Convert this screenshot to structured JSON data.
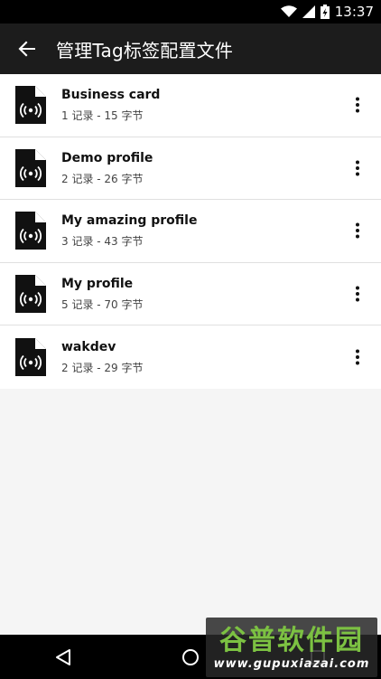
{
  "status_bar": {
    "time": "13:37"
  },
  "app_bar": {
    "title": "管理Tag标签配置文件"
  },
  "profiles": [
    {
      "name": "Business card",
      "meta": "1 记录 - 15 字节"
    },
    {
      "name": "Demo profile",
      "meta": "2 记录 - 26 字节"
    },
    {
      "name": "My amazing profile",
      "meta": "3 记录 - 43 字节"
    },
    {
      "name": "My profile",
      "meta": "5 记录 - 70 字节"
    },
    {
      "name": "wakdev",
      "meta": "2 记录 - 29 字节"
    }
  ],
  "icons": {
    "back": "arrow-back-icon",
    "file": "nfc-file-icon",
    "more": "more-vert-icon"
  },
  "colors": {
    "app_bar": "#1c1c1c",
    "status_bar": "#000000",
    "watermark_green": "#7cc142"
  },
  "watermark": {
    "main": "谷普软件园",
    "sub": "www.gupuxiazai.com"
  }
}
